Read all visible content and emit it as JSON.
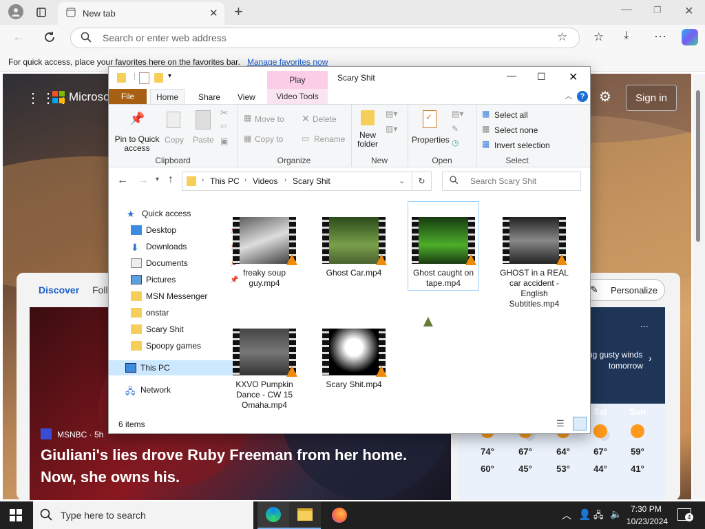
{
  "browser": {
    "tab_title": "New tab",
    "address_placeholder": "Search or enter web address",
    "favorites_msg": "For quick access, place your favorites here on the favorites bar.",
    "favorites_link": "Manage favorites now"
  },
  "msn": {
    "logo": "Microso",
    "sign_in": "Sign in",
    "discover": "Discover",
    "following": "Follo",
    "personalize": "Personalize",
    "news_source": "MSNBC · 5h",
    "headline_line1": "Giuliani's lies drove Ruby Freeman from her home.",
    "headline_line2": "Now, she owns his.",
    "weather_alert_1": "ng gusty winds",
    "weather_alert_2": "tomorrow",
    "weather_more": "...",
    "weather_days": [
      {
        "day": "",
        "high": "74°",
        "low": "60°",
        "icon": "sun-icon"
      },
      {
        "day": "",
        "high": "67°",
        "low": "45°",
        "icon": "partly-cloudy-icon"
      },
      {
        "day": "",
        "high": "64°",
        "low": "53°",
        "icon": "sun-icon"
      },
      {
        "day": "Sat",
        "high": "67°",
        "low": "44°",
        "icon": "partly-cloudy-icon"
      },
      {
        "day": "Sun",
        "high": "59°",
        "low": "41°",
        "icon": "sun-icon"
      }
    ]
  },
  "explorer": {
    "title": "Scary Shit",
    "context_tab": "Play",
    "context_subtab": "Video Tools",
    "tabs": {
      "file": "File",
      "home": "Home",
      "share": "Share",
      "view": "View"
    },
    "ribbon": {
      "pin": "Pin to Quick access",
      "copy": "Copy",
      "paste": "Paste",
      "clipboard": "Clipboard",
      "move_to": "Move to",
      "copy_to": "Copy to",
      "delete": "Delete",
      "rename": "Rename",
      "organize": "Organize",
      "new_folder": "New folder",
      "new": "New",
      "properties": "Properties",
      "open": "Open",
      "select_all": "Select all",
      "select_none": "Select none",
      "invert_selection": "Invert selection",
      "select": "Select"
    },
    "breadcrumb": [
      "This PC",
      "Videos",
      "Scary Shit"
    ],
    "search_placeholder": "Search Scary Shit",
    "nav": {
      "quick_access": "Quick access",
      "desktop": "Desktop",
      "downloads": "Downloads",
      "documents": "Documents",
      "pictures": "Pictures",
      "msn_messenger": "MSN Messenger",
      "onstar": "onstar",
      "scary_shit": "Scary Shit",
      "spoopy_games": "Spoopy games",
      "this_pc": "This PC",
      "network": "Network"
    },
    "files": [
      {
        "name": "freaky soup guy.mp4"
      },
      {
        "name": "Ghost Car.mp4"
      },
      {
        "name": "Ghost caught on tape.mp4"
      },
      {
        "name": "GHOST in a REAL car accident - English Subtitles.mp4"
      },
      {
        "name": "KXVO Pumpkin Dance - CW 15 Omaha.mp4"
      },
      {
        "name": "Scary Shit.mp4"
      }
    ],
    "item_count": "6 items"
  },
  "taskbar": {
    "search_placeholder": "Type here to search",
    "time": "7:30 PM",
    "date": "10/23/2024",
    "notifications": "4"
  }
}
